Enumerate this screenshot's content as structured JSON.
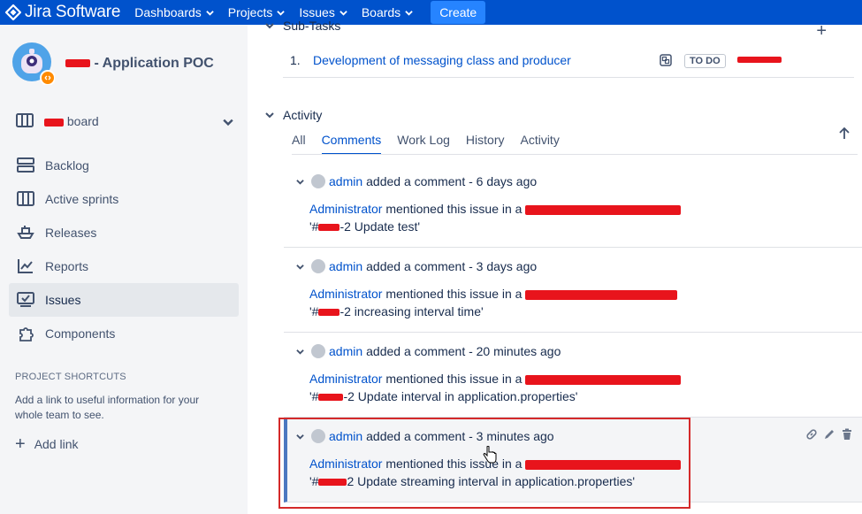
{
  "app": {
    "title": "Jira Software",
    "nav": [
      {
        "label": "Dashboards"
      },
      {
        "label": "Projects"
      },
      {
        "label": "Issues"
      },
      {
        "label": "Boards"
      }
    ],
    "create_label": "Create",
    "brand_color": "#0052cc",
    "create_color": "#2684ff"
  },
  "sidebar": {
    "project_name": "- Application POC",
    "board_label": "board",
    "items": [
      {
        "label": "Backlog",
        "icon": "backlog-icon"
      },
      {
        "label": "Active sprints",
        "icon": "board-icon"
      },
      {
        "label": "Releases",
        "icon": "ship-icon"
      },
      {
        "label": "Reports",
        "icon": "chart-icon"
      },
      {
        "label": "Issues",
        "icon": "issues-icon",
        "active": true
      },
      {
        "label": "Components",
        "icon": "puzzle-icon"
      }
    ],
    "shortcuts_title": "PROJECT SHORTCUTS",
    "shortcuts_desc": "Add a link to useful information for your whole team to see.",
    "add_link_label": "Add link"
  },
  "subtasks": {
    "title": "Sub-Tasks",
    "rows": [
      {
        "num": "1.",
        "title": "Development of messaging class and producer",
        "status": "TO DO"
      }
    ]
  },
  "activity": {
    "title": "Activity",
    "tabs": [
      "All",
      "Comments",
      "Work Log",
      "History",
      "Activity"
    ],
    "active_tab": "Comments",
    "comments": [
      {
        "author": "admin",
        "action": "added a comment - 6 days ago",
        "mention_author": "Administrator",
        "mention_text": "mentioned this issue in a",
        "commit_msg": "-2 Update test'",
        "prefix": "'#"
      },
      {
        "author": "admin",
        "action": "added a comment - 3 days ago",
        "mention_author": "Administrator",
        "mention_text": "mentioned this issue in a",
        "commit_msg": "-2 increasing interval time'",
        "prefix": "'#"
      },
      {
        "author": "admin",
        "action": "added a comment - 20 minutes ago",
        "mention_author": "Administrator",
        "mention_text": "mentioned this issue in a",
        "commit_msg": "-2 Update interval in application.properties'",
        "prefix": "'#"
      },
      {
        "author": "admin",
        "action": "added a comment - 3 minutes ago",
        "mention_author": "Administrator",
        "mention_text": "mentioned this issue in a",
        "commit_msg": "2 Update streaming interval in application.properties'",
        "prefix": "'#"
      }
    ]
  }
}
